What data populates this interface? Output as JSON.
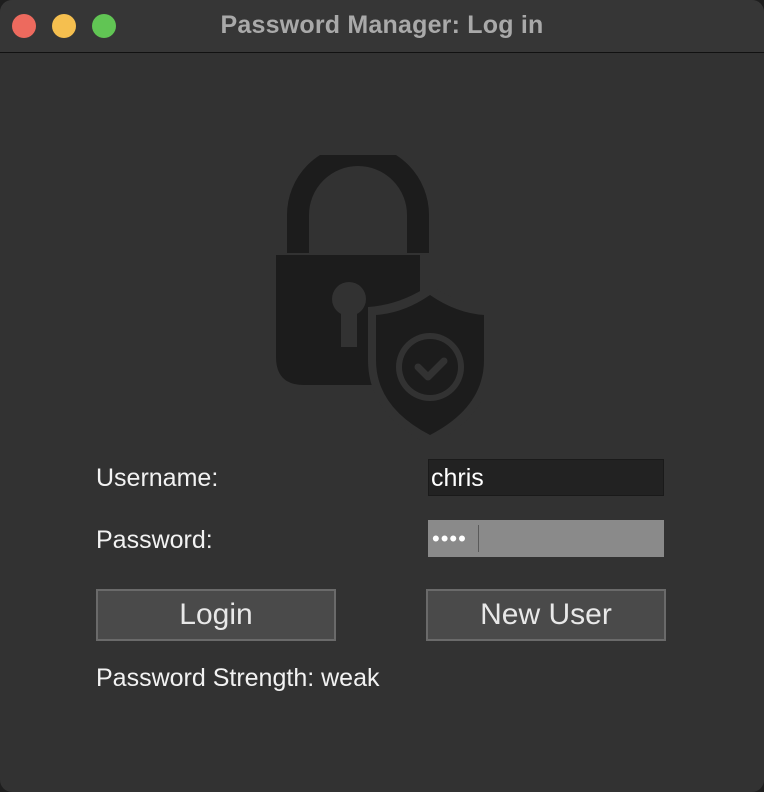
{
  "window": {
    "title": "Password Manager: Log in"
  },
  "logo": {
    "icon": "lock-shield-check-icon",
    "color": "#1c1c1c"
  },
  "form": {
    "username_label": "Username:",
    "username_value": "chris",
    "password_label": "Password:",
    "password_masked": "••••"
  },
  "buttons": {
    "login": "Login",
    "new_user": "New User"
  },
  "status": {
    "strength_text": "Password Strength: weak"
  },
  "colors": {
    "close": "#ed6a5e",
    "minimize": "#f5bf4f",
    "maximize": "#61c554",
    "background": "#323232"
  }
}
